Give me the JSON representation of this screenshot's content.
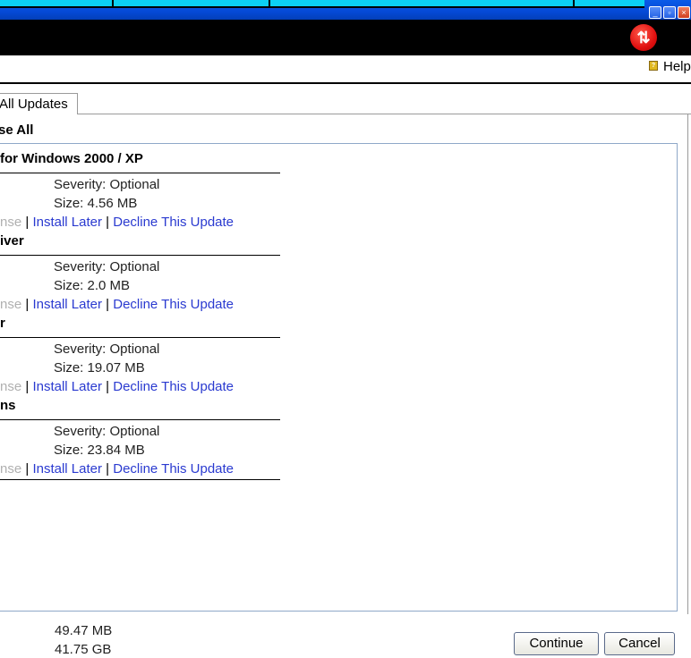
{
  "window": {
    "minimize_glyph": "_",
    "restore_glyph": "▫",
    "close_glyph": "×"
  },
  "toolbar": {
    "update_icon_glyph": "⇅"
  },
  "help": {
    "label": "Help"
  },
  "tabs": [
    {
      "label": "All Updates"
    }
  ],
  "collapse_all": {
    "label": "se All"
  },
  "updates": [
    {
      "name": "for Windows 2000 / XP",
      "severity": "Severity: Optional",
      "size": "Size: 4.56 MB",
      "license_label": "nse",
      "install_later": "Install Later",
      "decline": "Decline This Update"
    },
    {
      "name": "iver",
      "severity": "Severity: Optional",
      "size": "Size: 2.0 MB",
      "license_label": "nse",
      "install_later": "Install Later",
      "decline": "Decline This Update"
    },
    {
      "name": "r",
      "severity": "Severity: Optional",
      "size": "Size: 19.07 MB",
      "license_label": "nse",
      "install_later": "Install Later",
      "decline": "Decline This Update"
    },
    {
      "name": "ns",
      "severity": "Severity: Optional",
      "size": "Size: 23.84 MB",
      "license_label": "nse",
      "install_later": "Install Later",
      "decline": "Decline This Update"
    }
  ],
  "totals": {
    "download_size": "49.47 MB",
    "free_space": "41.75 GB"
  },
  "buttons": {
    "continue": "Continue",
    "cancel": "Cancel"
  },
  "colors": {
    "link": "#2a3ad0",
    "titlebar": "#0549d6",
    "accent_cyan": "#0cd0f4"
  }
}
